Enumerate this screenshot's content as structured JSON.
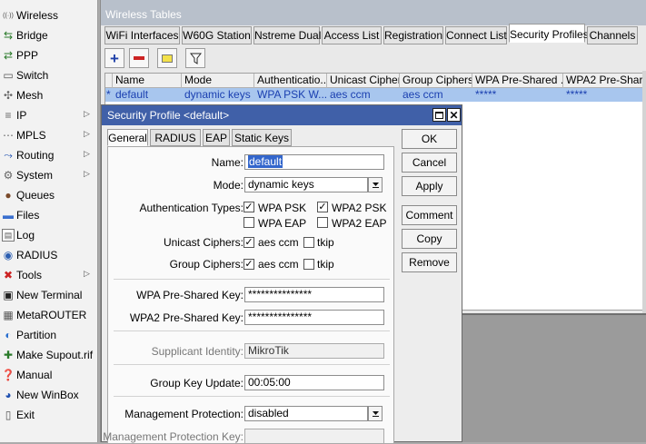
{
  "sidebar": {
    "items": [
      {
        "label": "Wireless",
        "icon": "wireless-icon",
        "color": "#444444",
        "arrow": false
      },
      {
        "label": "Bridge",
        "icon": "bridge-icon",
        "color": "#2a7a2a",
        "arrow": false
      },
      {
        "label": "PPP",
        "icon": "ppp-icon",
        "color": "#2a7a2a",
        "arrow": false
      },
      {
        "label": "Switch",
        "icon": "switch-icon",
        "color": "#555555",
        "arrow": false
      },
      {
        "label": "Mesh",
        "icon": "mesh-icon",
        "color": "#666666",
        "arrow": false
      },
      {
        "label": "IP",
        "icon": "ip-icon",
        "color": "#666666",
        "arrow": true
      },
      {
        "label": "MPLS",
        "icon": "mpls-icon",
        "color": "#666666",
        "arrow": true
      },
      {
        "label": "Routing",
        "icon": "routing-icon",
        "color": "#1e4fb0",
        "arrow": true
      },
      {
        "label": "System",
        "icon": "system-gear-icon",
        "color": "#666666",
        "arrow": true
      },
      {
        "label": "Queues",
        "icon": "queues-icon",
        "color": "#7a4a2a",
        "arrow": false
      },
      {
        "label": "Files",
        "icon": "files-icon",
        "color": "#3a6fcf",
        "arrow": false
      },
      {
        "label": "Log",
        "icon": "log-icon",
        "color": "#eeeeee",
        "arrow": false
      },
      {
        "label": "RADIUS",
        "icon": "radius-icon",
        "color": "#2a5db0",
        "arrow": false
      },
      {
        "label": "Tools",
        "icon": "tools-icon",
        "color": "#cc2222",
        "arrow": true
      },
      {
        "label": "New Terminal",
        "icon": "terminal-icon",
        "color": "#222222",
        "arrow": false
      },
      {
        "label": "MetaROUTER",
        "icon": "metarouter-icon",
        "color": "#555555",
        "arrow": false
      },
      {
        "label": "Partition",
        "icon": "partition-icon",
        "color": "#2a6fcf",
        "arrow": false
      },
      {
        "label": "Make Supout.rif",
        "icon": "supout-icon",
        "color": "#2a7a2a",
        "arrow": false
      },
      {
        "label": "Manual",
        "icon": "manual-icon",
        "color": "#1e4fb0",
        "arrow": false
      },
      {
        "label": "New WinBox",
        "icon": "winbox-icon",
        "color": "#1e4fb0",
        "arrow": false
      },
      {
        "label": "Exit",
        "icon": "exit-icon",
        "color": "#555555",
        "arrow": false
      }
    ]
  },
  "wireless_tables": {
    "title": "Wireless Tables",
    "tabs": [
      "WiFi Interfaces",
      "W60G Station",
      "Nstreme Dual",
      "Access List",
      "Registration",
      "Connect List",
      "Security Profiles",
      "Channels"
    ],
    "active_tab": "Security Profiles",
    "toolbar": {
      "add": "+",
      "remove": "−"
    },
    "columns": [
      "Name",
      "Mode",
      "Authenticatio...",
      "Unicast Ciphers",
      "Group Ciphers",
      "WPA Pre-Shared ...",
      "WPA2 Pre-Shared"
    ],
    "rows": [
      {
        "flag": "*",
        "cells": [
          "default",
          "dynamic keys",
          "WPA PSK W...",
          "aes ccm",
          "aes ccm",
          "*****",
          "*****"
        ]
      }
    ]
  },
  "dialog": {
    "title": "Security Profile <default>",
    "tabs": [
      "General",
      "RADIUS",
      "EAP",
      "Static Keys"
    ],
    "active_tab": "General",
    "form": {
      "name_label": "Name:",
      "name_value": "default",
      "mode_label": "Mode:",
      "mode_value": "dynamic keys",
      "auth_label": "Authentication Types:",
      "auth_types": [
        {
          "label": "WPA PSK",
          "checked": true
        },
        {
          "label": "WPA2 PSK",
          "checked": true
        },
        {
          "label": "WPA EAP",
          "checked": false
        },
        {
          "label": "WPA2 EAP",
          "checked": false
        }
      ],
      "unicast_label": "Unicast Ciphers:",
      "unicast_options": [
        {
          "label": "aes ccm",
          "checked": true
        },
        {
          "label": "tkip",
          "checked": false
        }
      ],
      "group_label": "Group Ciphers:",
      "group_options": [
        {
          "label": "aes ccm",
          "checked": true
        },
        {
          "label": "tkip",
          "checked": false
        }
      ],
      "wpa_psk_label": "WPA Pre-Shared Key:",
      "wpa_psk_value": "***************",
      "wpa2_psk_label": "WPA2 Pre-Shared Key:",
      "wpa2_psk_value": "***************",
      "supplicant_label": "Supplicant Identity:",
      "supplicant_value": "MikroTik",
      "gku_label": "Group Key Update:",
      "gku_value": "00:05:00",
      "mgmt_label": "Management Protection:",
      "mgmt_value": "disabled",
      "mgmt_key_label": "Management Protection Key:",
      "mgmt_key_value": ""
    },
    "buttons": [
      "OK",
      "Cancel",
      "Apply",
      "Comment",
      "Copy",
      "Remove"
    ]
  },
  "colors": {
    "title_active": "#4060a8",
    "title_inactive": "#b8c0cb",
    "row_selected": "#a8c6ee",
    "add_button": "#1e3fa8",
    "remove_button": "#cc2222"
  }
}
